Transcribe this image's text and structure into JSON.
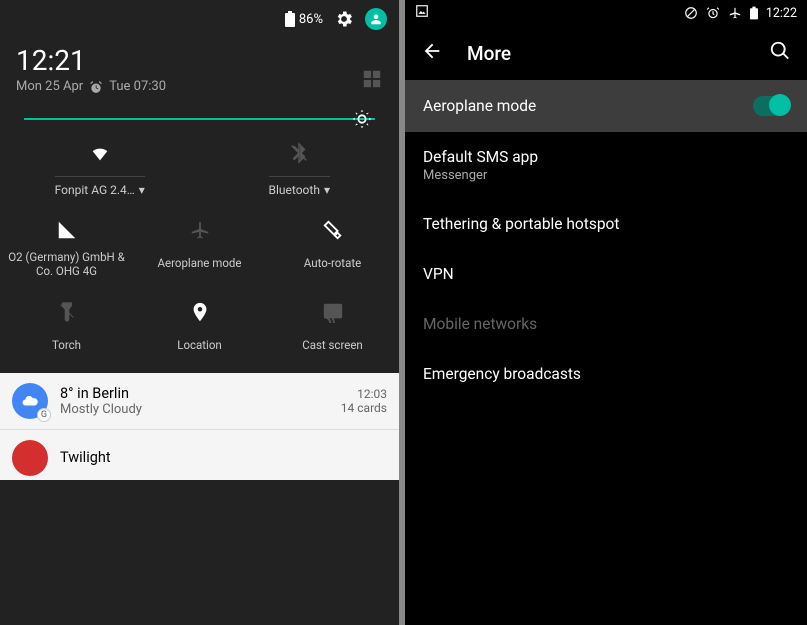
{
  "left": {
    "status": {
      "battery": "86%"
    },
    "time": "12:21",
    "date": "Mon 25 Apr",
    "alarm": "Tue 07:30",
    "quick_top": [
      {
        "label": "Fonpit AG 2.4…",
        "name": "wifi"
      },
      {
        "label": "Bluetooth",
        "name": "bluetooth"
      }
    ],
    "tiles": [
      {
        "label": "O2 (Germany) GmbH & Co. OHG 4G",
        "name": "cellular"
      },
      {
        "label": "Aeroplane mode",
        "name": "airplane"
      },
      {
        "label": "Auto-rotate",
        "name": "rotate"
      },
      {
        "label": "Torch",
        "name": "torch"
      },
      {
        "label": "Location",
        "name": "location"
      },
      {
        "label": "Cast screen",
        "name": "cast"
      }
    ],
    "notifications": [
      {
        "title": "8° in Berlin",
        "sub": "Mostly Cloudy",
        "time": "12:03",
        "meta": "14 cards",
        "color": "blue"
      },
      {
        "title": "Twilight",
        "sub": "",
        "time": "",
        "meta": "",
        "color": "red"
      }
    ]
  },
  "right": {
    "time": "12:22",
    "title": "More",
    "items": [
      {
        "label": "Aeroplane mode",
        "sub": "",
        "toggle": true,
        "active": true
      },
      {
        "label": "Default SMS app",
        "sub": "Messenger"
      },
      {
        "label": "Tethering & portable hotspot",
        "sub": ""
      },
      {
        "label": "VPN",
        "sub": ""
      },
      {
        "label": "Mobile networks",
        "sub": "",
        "dim": true
      },
      {
        "label": "Emergency broadcasts",
        "sub": ""
      }
    ]
  }
}
